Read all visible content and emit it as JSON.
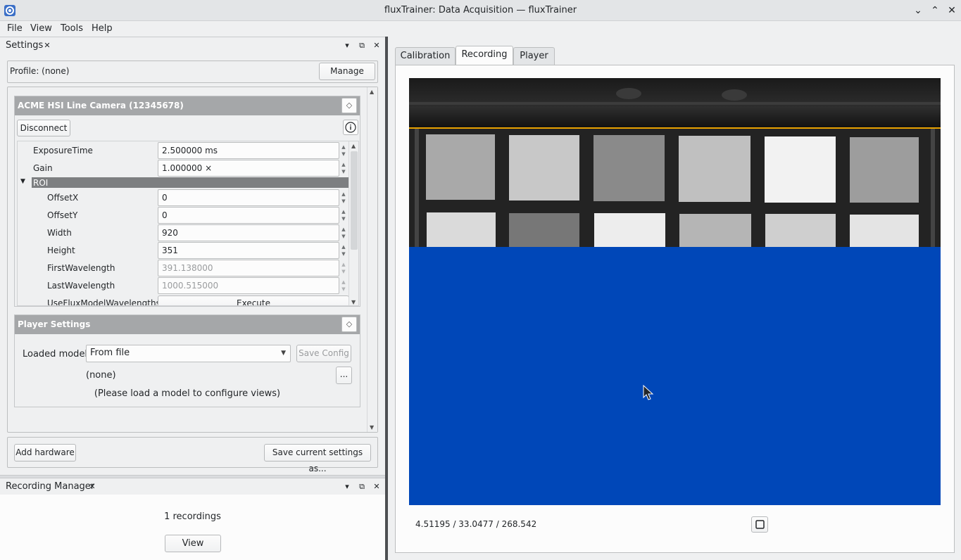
{
  "window": {
    "title": "fluxTrainer: Data Acquisition — fluxTrainer",
    "controls": [
      "chevron-down",
      "chevron-up",
      "close"
    ]
  },
  "menu": [
    "File",
    "View",
    "Tools",
    "Help"
  ],
  "settings_dock": {
    "title": "Settings",
    "profile_label": "Profile:  (none)",
    "manage_label": "Manage",
    "camera": {
      "title": "ACME HSI Line Camera (12345678)",
      "disconnect_label": "Disconnect",
      "properties": [
        {
          "label": "ExposureTime",
          "value": "2.500000 ms"
        },
        {
          "label": "Gain",
          "value": "1.000000 ×"
        }
      ],
      "roi_label": "ROI",
      "roi_properties": [
        {
          "label": "OffsetX",
          "value": "0"
        },
        {
          "label": "OffsetY",
          "value": "0"
        },
        {
          "label": "Width",
          "value": "920"
        },
        {
          "label": "Height",
          "value": "351"
        },
        {
          "label": "FirstWavelength",
          "value": "391.138000"
        },
        {
          "label": "LastWavelength",
          "value": "1000.515000"
        }
      ],
      "action_label": "UseFluxModelWavelengths",
      "action_button": "Execute"
    },
    "player_settings": {
      "title": "Player Settings",
      "loaded_model_label": "Loaded model:",
      "loaded_model_value": "From file",
      "save_config_label": "Save Config",
      "model_name": "(none)",
      "browse_label": "...",
      "hint": "(Please load a model to configure views)"
    },
    "add_hardware_label": "Add hardware",
    "save_settings_label": "Save current settings as..."
  },
  "recording_dock": {
    "title": "Recording Manager",
    "count_text": "1 recordings",
    "view_label": "View"
  },
  "tabs": [
    "Calibration",
    "Recording",
    "Player"
  ],
  "active_tab": "Recording",
  "viewer": {
    "status_text": "4.51195 / 33.0477 / 268.542",
    "overlay_color": "#0047b8",
    "line_color": "#f0a000"
  }
}
